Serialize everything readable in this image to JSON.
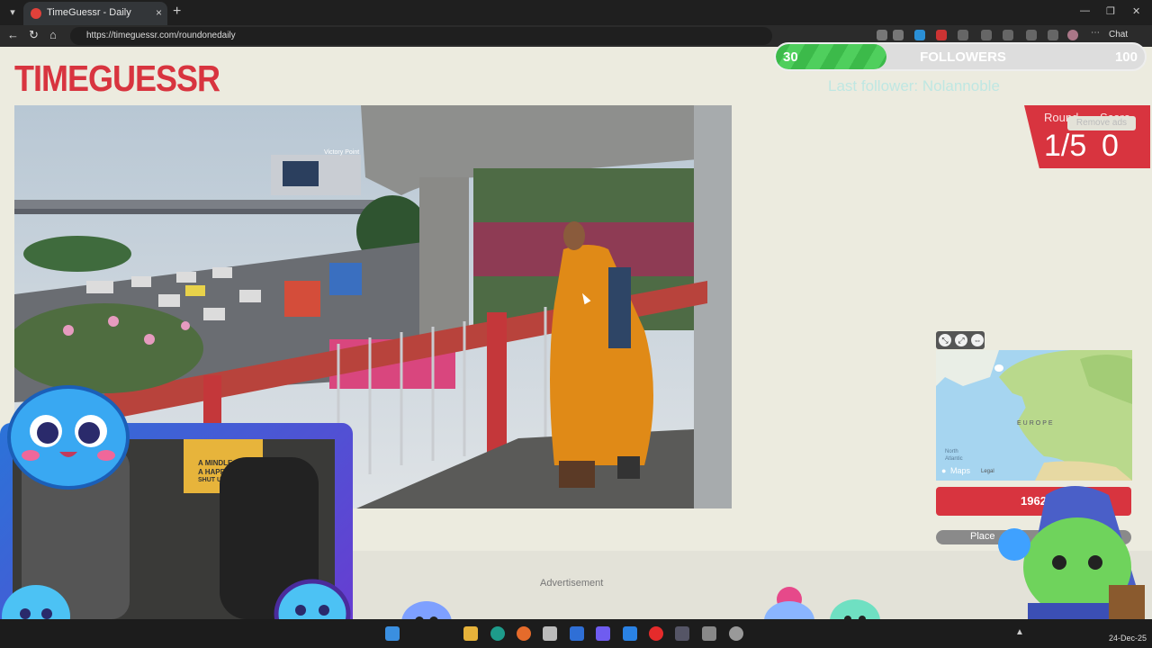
{
  "browser": {
    "tab_title": "TimeGuessr - Daily",
    "tab_close": "×",
    "new_tab": "+",
    "url": "https://timeguessr.com/roundonedaily",
    "chat_label": "Chat",
    "nav_back": "←",
    "nav_refresh": "↻",
    "nav_home": "⌂",
    "win_min": "—",
    "win_max": "❐",
    "win_close": "✕"
  },
  "page": {
    "logo": "TIMEGUESSR",
    "round_label": "Round",
    "score_label": "Score",
    "round_value": "1/5",
    "score_value": "0",
    "advertisement": "Advertisement",
    "remove_ads": "Remove ads"
  },
  "stream": {
    "followers_current": "30",
    "followers_label": "FOLLOWERS",
    "followers_goal": "100",
    "followers_progress": 0.3,
    "last_follower": "Last follower: Nolannoble"
  },
  "map": {
    "region_label": "EUROPE",
    "ocean_label_1": "North",
    "ocean_label_2": "Atlantic",
    "brand": "Maps",
    "legal": "Legal"
  },
  "guess": {
    "year": "1962",
    "place_button": "Place"
  },
  "photo_signs": {
    "billboard": "Victory Point",
    "wall_text_1": "A MINDLE",
    "wall_text_2": "A HAPP",
    "wall_text_3": "SHUT UP A"
  },
  "taskbar": {
    "date": "24-Dec-25"
  }
}
